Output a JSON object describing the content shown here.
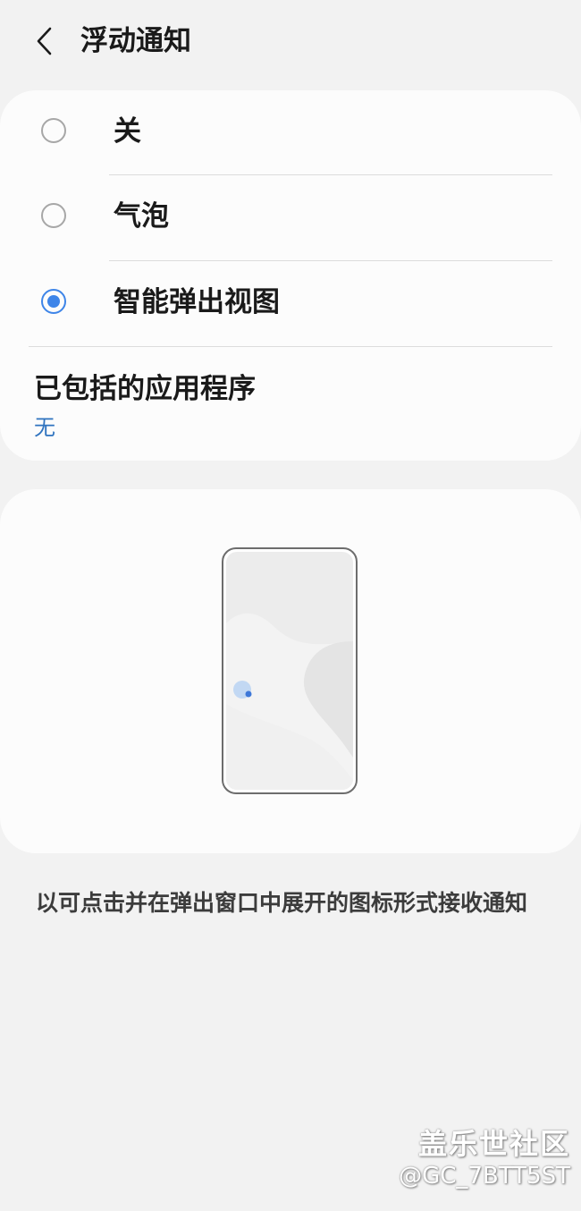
{
  "header": {
    "back_icon": "chevron-left-icon",
    "title": "浮动通知"
  },
  "options": [
    {
      "label": "关",
      "selected": false
    },
    {
      "label": "气泡",
      "selected": false
    },
    {
      "label": "智能弹出视图",
      "selected": true
    }
  ],
  "included_apps": {
    "title": "已包括的应用程序",
    "value": "无"
  },
  "description": "以可点击并在弹出窗口中展开的图标形式接收通知",
  "watermark": {
    "line1": "盖乐世社区",
    "line2": "@GC_7BTT5ST"
  },
  "colors": {
    "accent": "#3e85e8",
    "link": "#2f73bf",
    "background": "#f2f2f2",
    "card": "#fcfcfc"
  }
}
